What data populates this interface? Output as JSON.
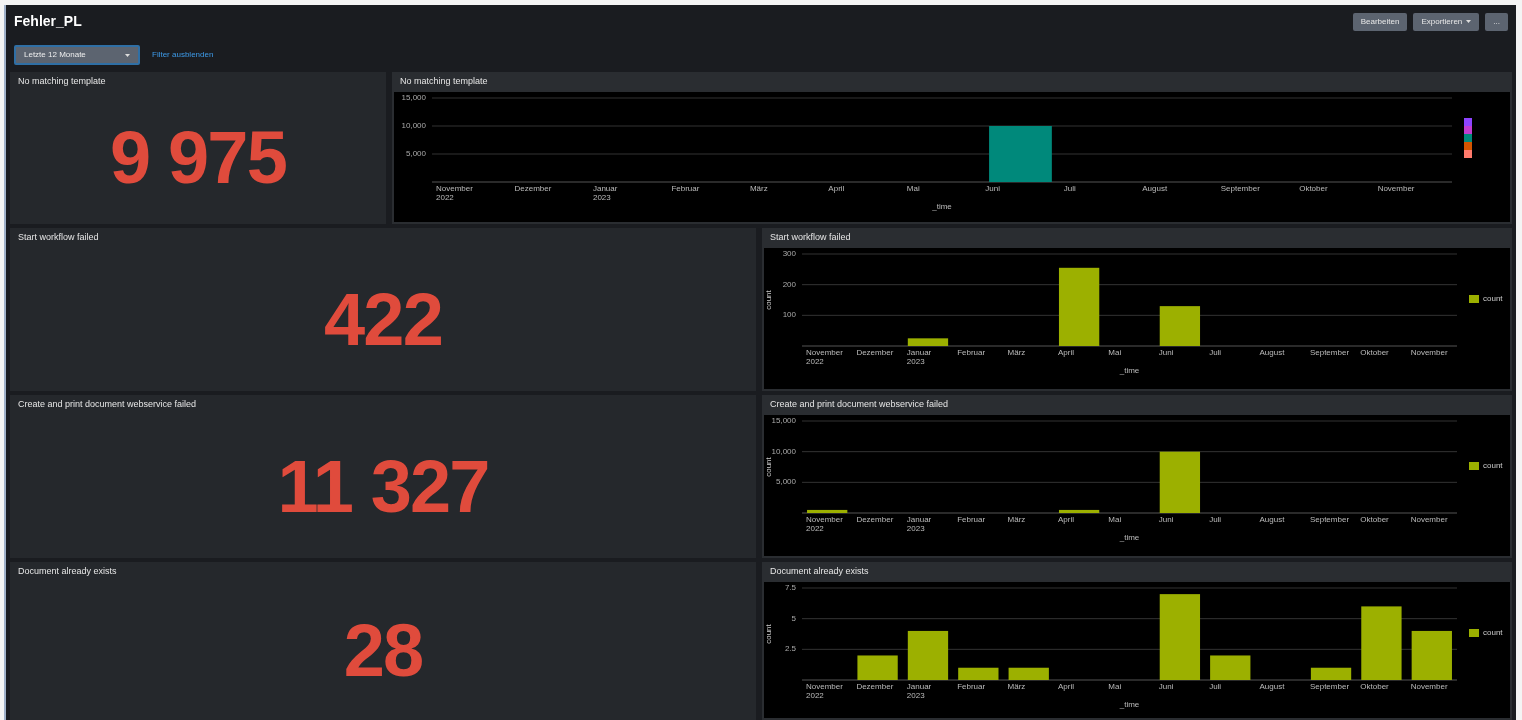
{
  "title": "Fehler_PL",
  "actions": [
    {
      "label": "Bearbeiten",
      "kind": "plain"
    },
    {
      "label": "Exportieren",
      "kind": "menu"
    },
    {
      "label": "...",
      "kind": "plain"
    }
  ],
  "time_picker": {
    "value": "Letzte 12 Monate"
  },
  "filter_link": "Filter ausblenden",
  "panels": [
    {
      "single": {
        "title": "No matching template",
        "value": "9 975"
      },
      "chart": {
        "title": "No matching template",
        "chart_data": {
          "type": "bar",
          "xlabel": "_time",
          "categories": [
            "November 2022",
            "Dezember",
            "Januar 2023",
            "Februar",
            "März",
            "April",
            "Mai",
            "Juni",
            "Juli",
            "August",
            "September",
            "Oktober",
            "November"
          ],
          "ylim": [
            0,
            15000
          ],
          "yticks": [
            {
              "value": 5000,
              "label": "5,000"
            },
            {
              "value": 10000,
              "label": "10,000"
            },
            {
              "value": 15000,
              "label": "15,000"
            }
          ],
          "series": [
            {
              "color": "#00897b",
              "values": [
                0,
                0,
                0,
                0,
                0,
                0,
                0,
                10000,
                0,
                0,
                0,
                0,
                0
              ]
            }
          ]
        }
      }
    },
    {
      "single": {
        "title": "Start workflow failed",
        "value": "422"
      },
      "chart": {
        "title": "Start workflow failed",
        "chart_data": {
          "type": "bar",
          "xlabel": "_time",
          "ylabel": "count",
          "categories": [
            "November 2022",
            "Dezember",
            "Januar 2023",
            "Februar",
            "März",
            "April",
            "Mai",
            "Juni",
            "Juli",
            "August",
            "September",
            "Oktober",
            "November"
          ],
          "ylim": [
            0,
            300
          ],
          "yticks": [
            {
              "value": 100,
              "label": "100"
            },
            {
              "value": 200,
              "label": "200"
            },
            {
              "value": 300,
              "label": "300"
            }
          ],
          "series": [
            {
              "name": "count",
              "color": "#9cb000",
              "values": [
                0,
                0,
                25,
                0,
                0,
                255,
                0,
                130,
                0,
                0,
                0,
                0,
                0
              ]
            }
          ]
        }
      }
    },
    {
      "single": {
        "title": "Create and print document webservice failed",
        "value": "11 327"
      },
      "chart": {
        "title": "Create and print document webservice failed",
        "chart_data": {
          "type": "bar",
          "xlabel": "_time",
          "ylabel": "count",
          "categories": [
            "November 2022",
            "Dezember",
            "Januar 2023",
            "Februar",
            "März",
            "April",
            "Mai",
            "Juni",
            "Juli",
            "August",
            "September",
            "Oktober",
            "November"
          ],
          "ylim": [
            0,
            15000
          ],
          "yticks": [
            {
              "value": 5000,
              "label": "5,000"
            },
            {
              "value": 10000,
              "label": "10,000"
            },
            {
              "value": 15000,
              "label": "15,000"
            }
          ],
          "series": [
            {
              "name": "count",
              "color": "#9cb000",
              "values": [
                500,
                0,
                0,
                0,
                0,
                500,
                0,
                10000,
                0,
                0,
                0,
                0,
                0
              ]
            }
          ]
        }
      }
    },
    {
      "single": {
        "title": "Document already exists",
        "value": "28"
      },
      "chart": {
        "title": "Document already exists",
        "chart_data": {
          "type": "bar",
          "xlabel": "_time",
          "ylabel": "count",
          "categories": [
            "November 2022",
            "Dezember",
            "Januar 2023",
            "Februar",
            "März",
            "April",
            "Mai",
            "Juni",
            "Juli",
            "August",
            "September",
            "Oktober",
            "November"
          ],
          "ylim": [
            0,
            7.5
          ],
          "yticks": [
            {
              "value": 2.5,
              "label": "2.5"
            },
            {
              "value": 5,
              "label": "5"
            },
            {
              "value": 7.5,
              "label": "7.5"
            }
          ],
          "series": [
            {
              "name": "count",
              "color": "#9cb000",
              "values": [
                0,
                2,
                4,
                1,
                1,
                0,
                0,
                7,
                2,
                0,
                1,
                6,
                4
              ]
            }
          ]
        }
      }
    }
  ]
}
